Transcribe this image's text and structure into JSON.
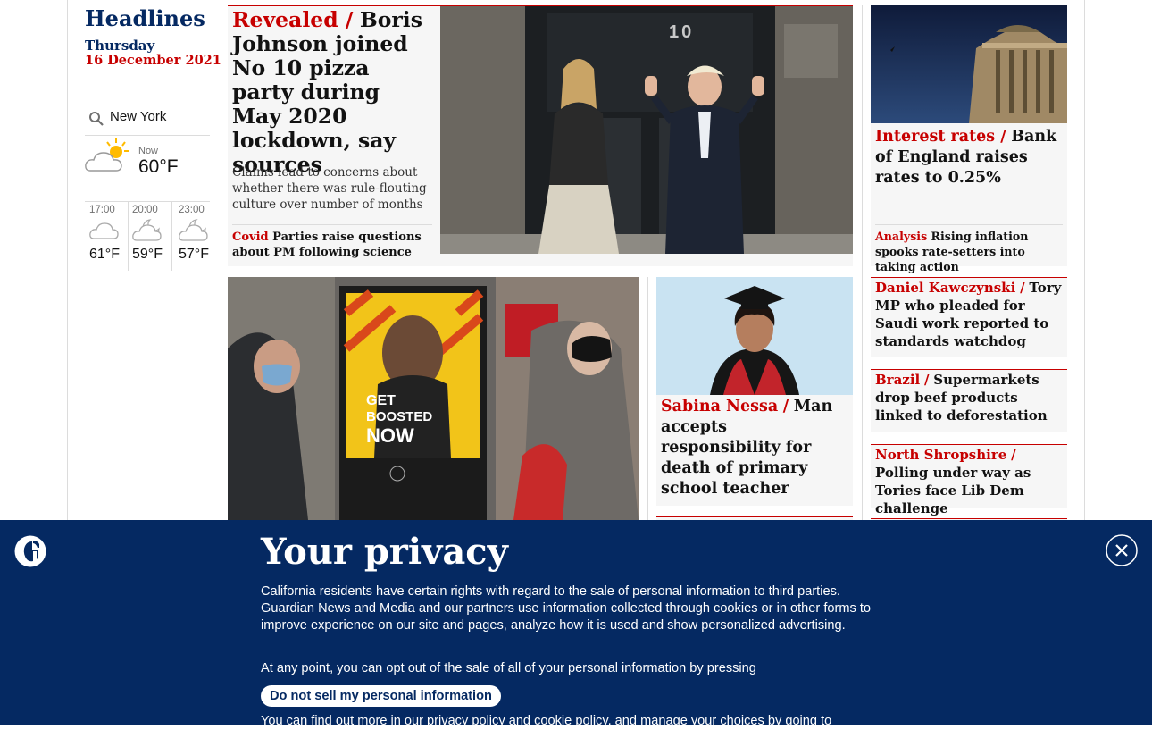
{
  "sidebar": {
    "title": "Headlines",
    "day": "Thursday",
    "date": "16 December 2021",
    "weather": {
      "location": "New York",
      "now_label": "Now",
      "now_temp": "60°F",
      "forecast": [
        {
          "time": "17:00",
          "temp": "61°F"
        },
        {
          "time": "20:00",
          "temp": "59°F"
        },
        {
          "time": "23:00",
          "temp": "57°F"
        }
      ]
    }
  },
  "lead": {
    "kicker": "Revealed /",
    "headline": "Boris Johnson joined No 10 pizza party during May 2020 lockdown, say sources",
    "standfirst": "Claims lead to concerns about whether there was rule-flouting culture over number of months",
    "sublink_kicker": "Covid",
    "sublink_text": "Parties raise questions about PM following science",
    "image_door_number": "10"
  },
  "rates": {
    "kicker": "Interest rates /",
    "headline": "Bank of England raises rates to 0.25%",
    "sublink_kicker": "Analysis",
    "sublink_text": "Rising inflation spooks rate-setters into taking action"
  },
  "covid_image": {
    "poster_line1": "GET",
    "poster_line2": "BOOSTED",
    "poster_line3": "NOW"
  },
  "nessa": {
    "kicker": "Sabina Nessa",
    "separator": "/",
    "headline": "Man accepts responsibility for death of primary school teacher"
  },
  "right_list": [
    {
      "kicker": "Daniel Kawczynski",
      "separator": "/",
      "headline": "Tory MP who pleaded for Saudi work reported to standards watchdog"
    },
    {
      "kicker": "Brazil",
      "separator": "/",
      "headline": "Supermarkets drop beef products linked to deforestation"
    },
    {
      "kicker": "North Shropshire",
      "separator": "/",
      "headline": "Polling under way as Tories face Lib Dem challenge"
    }
  ],
  "privacy": {
    "title": "Your privacy",
    "para1": "California residents have certain rights with regard to the sale of personal information to third parties. Guardian News and Media and our partners use information collected through cookies or in other forms to improve experience on our site and pages, analyze how it is used and show personalized advertising.",
    "para2": "At any point, you can opt out of the sale of all of your personal information by pressing",
    "button": "Do not sell my personal information",
    "para3": "You can find out more in our privacy policy and cookie policy, and manage your choices by going to"
  },
  "colors": {
    "guardian_red": "#c70000",
    "guardian_blue": "#052962",
    "card_bg": "#f6f6f6"
  },
  "icons": [
    "guardian-logo-icon",
    "close-icon",
    "search-icon",
    "partly-sunny-icon",
    "cloudy-night-icon"
  ]
}
